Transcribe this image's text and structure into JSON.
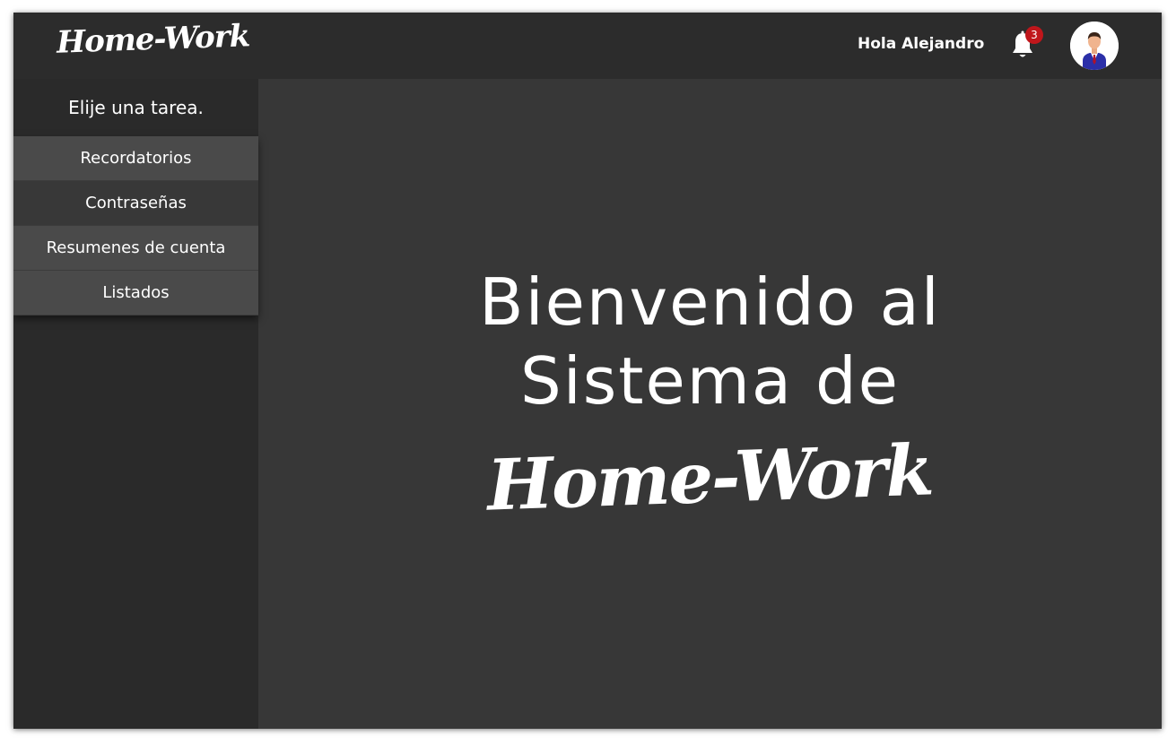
{
  "header": {
    "logo": "Home-Work",
    "greeting": "Hola Alejandro",
    "notification_count": "3",
    "bell_icon": "bell-icon",
    "avatar_icon": "user-avatar-icon"
  },
  "sidebar": {
    "title": "Elije una tarea.",
    "items": [
      {
        "label": "Recordatorios"
      },
      {
        "label": "Contraseñas"
      },
      {
        "label": "Resumenes de cuenta"
      },
      {
        "label": "Listados"
      }
    ]
  },
  "main": {
    "welcome_line1": "Bienvenido al",
    "welcome_line2": "Sistema de",
    "logo": "Home-Work"
  },
  "colors": {
    "topbar": "#2c2c2c",
    "sidebar": "#2a2a2a",
    "content": "#373737",
    "menu_light": "#4a4a4a",
    "menu_dark": "#383838",
    "badge": "#c0161b"
  }
}
